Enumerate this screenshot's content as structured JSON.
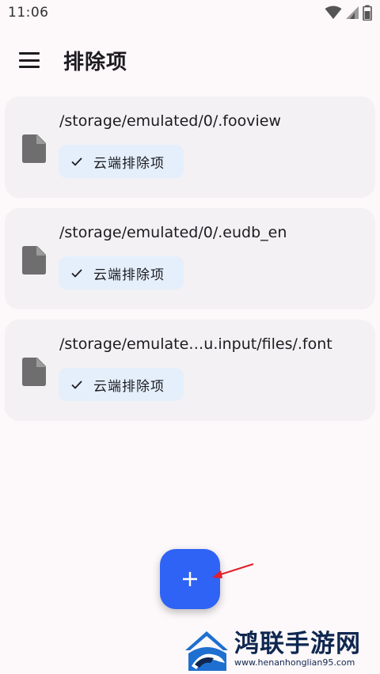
{
  "status_bar": {
    "time": "11:06"
  },
  "top_bar": {
    "title": "排除项",
    "menu_icon": "hamburger-menu-icon"
  },
  "items": [
    {
      "path": "/storage/emulated/0/.fooview",
      "chip": "云端排除项",
      "icon": "file-icon"
    },
    {
      "path": "/storage/emulated/0/.eudb_en",
      "chip": "云端排除项",
      "icon": "file-icon"
    },
    {
      "path": "/storage/emulate…u.input/files/.font",
      "chip": "云端排除项",
      "icon": "file-icon"
    }
  ],
  "fab": {
    "icon": "plus-icon"
  },
  "watermark": {
    "name": "鸿联手游网",
    "url": "www.henanhonglian95.com"
  },
  "colors": {
    "fab": "#2f63f5",
    "chip_bg": "#e5effc",
    "card_bg": "#f3f1f3",
    "arrow": "#e0202c"
  }
}
